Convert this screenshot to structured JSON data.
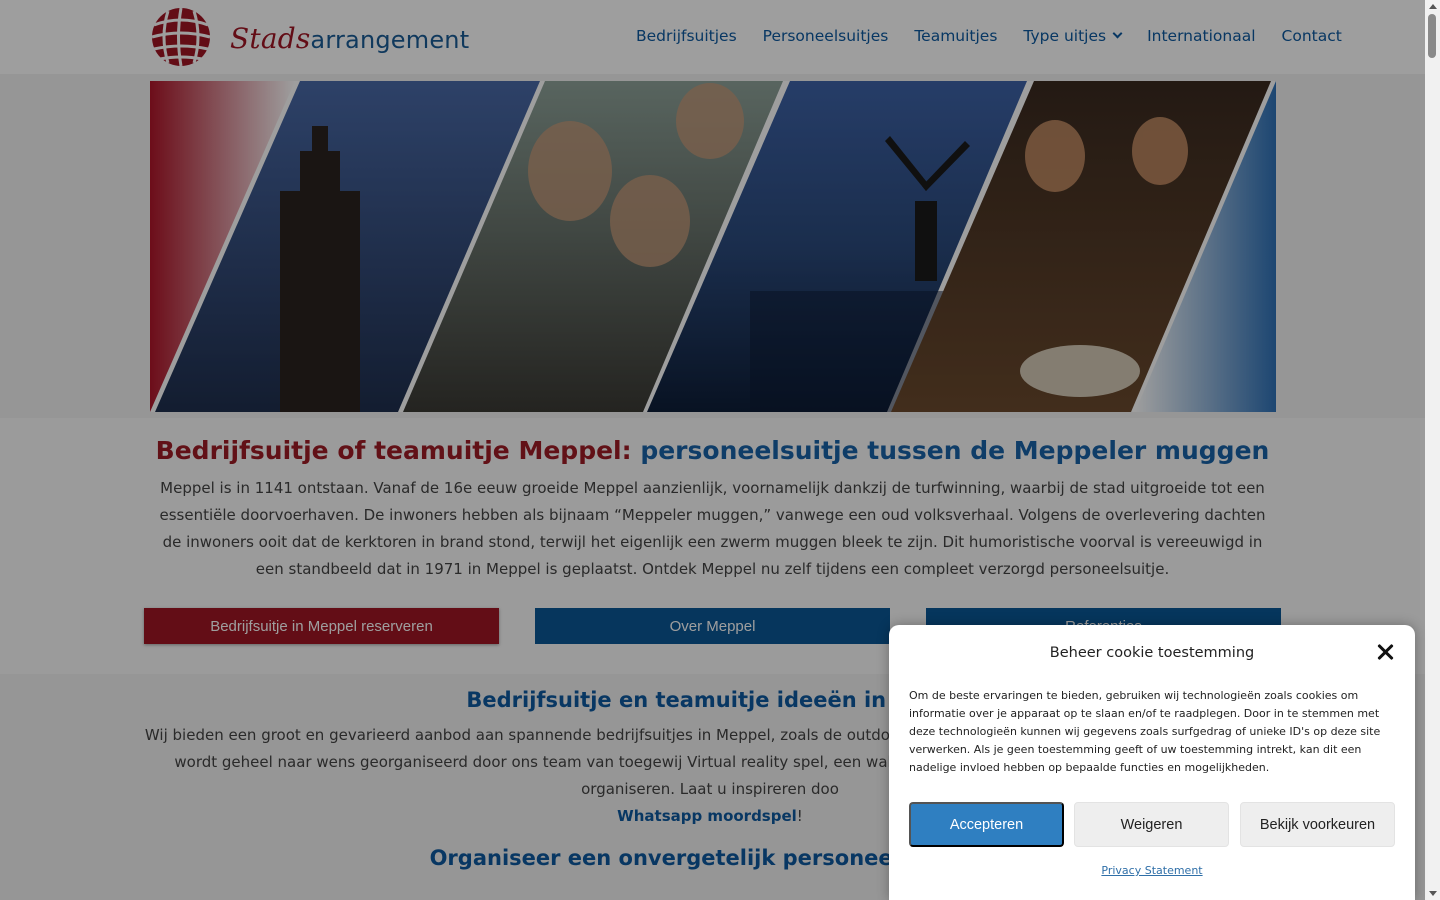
{
  "brand": {
    "logo_icon": "red-tile-sphere-icon",
    "name_part1": "Stads",
    "name_part2": "arrangement",
    "color_red": "#a11525",
    "color_blue": "#1b5c96"
  },
  "nav": {
    "items": [
      {
        "label": "Bedrijfsuitjes"
      },
      {
        "label": "Personeelsuitjes"
      },
      {
        "label": "Teamuitjes"
      },
      {
        "label": "Type uitjes"
      },
      {
        "label": "Internationaal"
      },
      {
        "label": "Contact"
      }
    ]
  },
  "hero": {
    "panels": [
      "church-tower-photo",
      "friends-selfie-photo",
      "windmill-harbour-photo",
      "dinner-group-photo"
    ]
  },
  "main": {
    "heading_part1": "Bedrijfsuitje of teamuitje Meppel:",
    "heading_part2": "personeelsuitje tussen de Meppeler muggen",
    "intro": "Meppel is in 1141 ontstaan. Vanaf de 16e eeuw groeide Meppel aanzienlijk, voornamelijk dankzij de turfwinning, waarbij de stad uitgroeide tot een essentiële doorvoerhaven. De inwoners hebben als bijnaam “Meppeler muggen,” vanwege een oud volksverhaal. Volgens de overlevering dachten de inwoners ooit dat de kerktoren in brand stond, terwijl het eigenlijk een zwerm muggen bleek te zijn. Dit humoristische voorval is vereeuwigd in een standbeeld dat in 1971 in Meppel is geplaatst. Ontdek Meppel nu zelf tijdens een compleet verzorgd personeelsuitje.",
    "btn_reserve": "Bedrijfsuitje in Meppel reserveren",
    "btn_about": "Over Meppel",
    "btn_refs": "Referenties",
    "section2_heading": "Bedrijfsuitje en teamuitje ideeën in Mepp",
    "section2_text": "Wij bieden een groot en gevarieerd aanbod aan spannende bedrijfsuitjes in Meppel, zoals de outdoor escape ontvoerd spel. Uw bedrijfsuitje in Meppel wordt geheel naar wens georganiseerd door ons team van toegewij Virtual reality spel, een walking dinner of een Kraak de Code arrangement organiseren. Laat u inspireren doo",
    "section2_link": "Whatsapp moordspel",
    "section2_link_suffix": "!",
    "section3_heading": "Organiseer een onvergetelijk personeelsuitje in"
  },
  "cookie": {
    "title": "Beheer cookie toestemming",
    "text": "Om de beste ervaringen te bieden, gebruiken wij technologieën zoals cookies om informatie over je apparaat op te slaan en/of te raadplegen. Door in te stemmen met deze technologieën kunnen wij gegevens zoals surfgedrag of unieke ID's op deze site verwerken. Als je geen toestemming geeft of uw toestemming intrekt, kan dit een nadelige invloed hebben op bepaalde functies en mogelijkheden.",
    "accept": "Accepteren",
    "deny": "Weigeren",
    "preferences": "Bekijk voorkeuren",
    "privacy": "Privacy Statement",
    "accent": "#2f7fc1"
  }
}
